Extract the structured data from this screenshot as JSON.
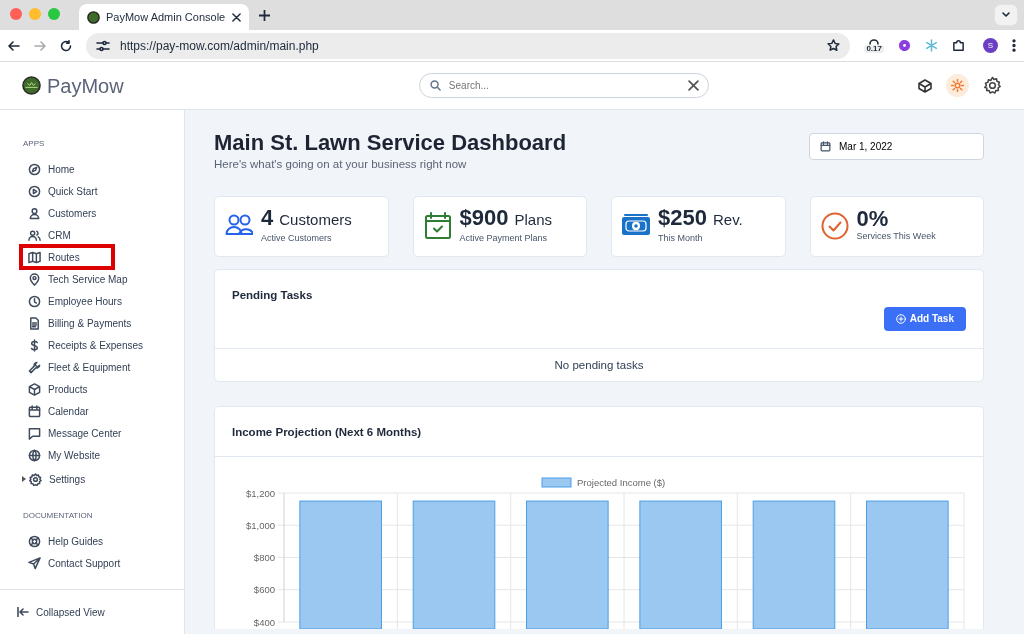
{
  "browser": {
    "tab_title": "PayMow Admin Console",
    "url": "https://pay-mow.com/admin/main.php",
    "extension_badge": "0.17",
    "profile_initial": "S"
  },
  "header": {
    "brand": "PayMow",
    "search": {
      "placeholder": "Search..."
    }
  },
  "sidebar": {
    "sections": [
      {
        "heading": "APPS",
        "items": [
          {
            "label": "Home",
            "highlighted": false
          },
          {
            "label": "Quick Start",
            "highlighted": false
          },
          {
            "label": "Customers",
            "highlighted": false
          },
          {
            "label": "CRM",
            "highlighted": false
          },
          {
            "label": "Routes",
            "highlighted": true
          },
          {
            "label": "Tech Service Map",
            "highlighted": false
          },
          {
            "label": "Employee Hours",
            "highlighted": false
          },
          {
            "label": "Billing & Payments",
            "highlighted": false
          },
          {
            "label": "Receipts & Expenses",
            "highlighted": false
          },
          {
            "label": "Fleet & Equipment",
            "highlighted": false
          },
          {
            "label": "Products",
            "highlighted": false
          },
          {
            "label": "Calendar",
            "highlighted": false
          },
          {
            "label": "Message Center",
            "highlighted": false
          },
          {
            "label": "My Website",
            "highlighted": false
          },
          {
            "label": "Settings",
            "highlighted": false,
            "expanded": false
          }
        ]
      },
      {
        "heading": "DOCUMENTATION",
        "items": [
          {
            "label": "Help Guides",
            "highlighted": false
          },
          {
            "label": "Contact Support",
            "highlighted": false
          }
        ]
      }
    ],
    "footer": "Collapsed View"
  },
  "page": {
    "title": "Main St. Lawn Service Dashboard",
    "subtitle": "Here's what's going on at your business right now",
    "date": "Mar 1, 2022"
  },
  "stats": [
    {
      "value": "4",
      "unit": "Customers",
      "caption": "Active Customers",
      "color": "#2563eb"
    },
    {
      "value": "$900",
      "unit": "Plans",
      "caption": "Active Payment Plans",
      "color": "#2e7d32"
    },
    {
      "value": "$250",
      "unit": "Rev.",
      "caption": "This Month",
      "color": "#1a73c8"
    },
    {
      "value": "0%",
      "caption": "Services This Week",
      "color": "#e0622a"
    }
  ],
  "pending_tasks": {
    "title": "Pending Tasks",
    "button": "Add Task",
    "empty_message": "No pending tasks"
  },
  "income_card": {
    "title": "Income Projection (Next 6 Months)",
    "chart_data": {
      "type": "bar",
      "series": [
        {
          "name": "Projected Income ($)",
          "color": "#9ac8f0",
          "values": [
            1150,
            1150,
            1150,
            1150,
            1150,
            1150
          ]
        }
      ],
      "ylim": [
        400,
        1200
      ],
      "grid": true,
      "yticks": [
        {
          "value": 400,
          "label": "$400"
        },
        {
          "value": 600,
          "label": "$600"
        },
        {
          "value": 800,
          "label": "$800"
        },
        {
          "value": 1000,
          "label": "$1,000"
        },
        {
          "value": 1200,
          "label": "$1,200"
        }
      ]
    }
  }
}
